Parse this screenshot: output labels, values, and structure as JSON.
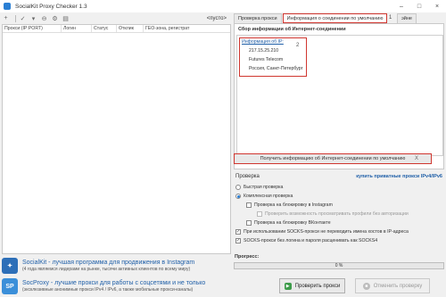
{
  "window": {
    "title": "SocialKit Proxy Checker 1.3",
    "controls": {
      "minimize": "–",
      "maximize": "□",
      "close": "×"
    }
  },
  "toolbar": {
    "icons": [
      "add-icon",
      "check-icon",
      "delete-icon",
      "settings-icon",
      "export-icon"
    ],
    "empty_label": "<пусто>"
  },
  "proxy_table": {
    "columns": [
      "Прокси (IP:PORT)",
      "Логин",
      "Статус",
      "Отклик",
      "ГЕО-зона, регистрат"
    ],
    "rows": []
  },
  "promos": {
    "socialkit": {
      "title": "SocialKit - лучшая программа для продвижения в Instagram",
      "subtitle": "(4 года являемся лидерами на рынке, тысячи активных клиентов по всему миру)"
    },
    "socproxy": {
      "title": "SocProxy - лучшие прокси для работы с соцсетями и не только",
      "subtitle": "(эксклюзивные анонимные прокси IPv4 / IPv6, а также мобильные прокси-каналы)"
    }
  },
  "tabs": {
    "check_proxy": "Проверка прокси",
    "default_connection": "Информация о соединении по умолчанию",
    "number": "1",
    "other": "эйне"
  },
  "info_panel": {
    "heading": "Сбор информации об Интернет-соединении",
    "ip_label": "Информация об IP:",
    "ip": "217.15.25.210",
    "provider": "Futures Telecom",
    "location": "Россия, Санкт-Петербург",
    "copy_num": "2"
  },
  "get_info": {
    "label": "Получить информацию об Интернет-соединении по умолчанию",
    "close": "X"
  },
  "check": {
    "title": "Проверка",
    "buy_link": "купить приватные прокси IPv4/IPv6",
    "options": {
      "quick": "Быстрая проверка",
      "full": "Комплексная проверка",
      "instagram": "Проверка на блокировку в Instagram",
      "instagram_profiles": "Проверить возможность просматривать профили без авторизации",
      "vk": "Проверка на блокировку ВКонтакте",
      "socks_names": "При использовании SOCKS-прокси не переводить имена хостов в IP-адреса",
      "socks4": "SOCKS-прокси без логина и пароля расценивать как SOCKS4"
    }
  },
  "progress": {
    "label": "Прогресс:",
    "percent_text": "0 %",
    "value": 0
  },
  "buttons": {
    "check": "Проверить прокси",
    "cancel": "Отменить проверку"
  },
  "colors": {
    "highlight": "#d0362f",
    "link": "#1f5fa8",
    "brand": "#2d6fb8"
  }
}
